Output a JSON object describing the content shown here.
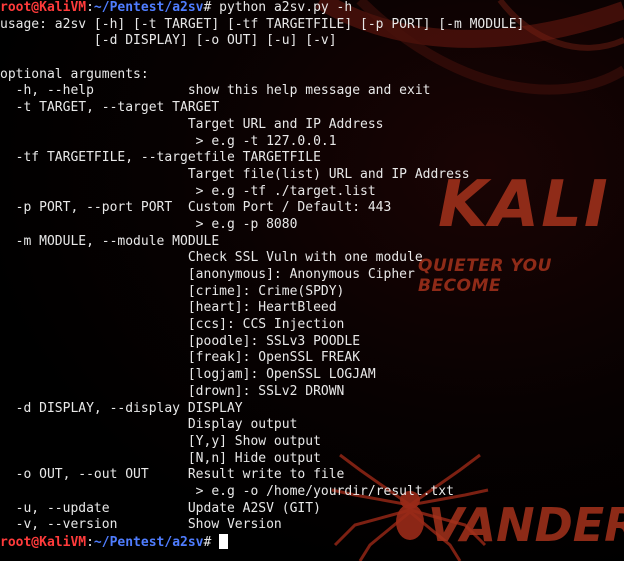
{
  "prompt": {
    "user_host": "root@KaliVM",
    "separator": ":",
    "path": "~/Pentest/a2sv",
    "symbol": "# "
  },
  "command": "python a2sv.py -h",
  "lines": [
    "usage: a2sv [-h] [-t TARGET] [-tf TARGETFILE] [-p PORT] [-m MODULE]",
    "            [-d DISPLAY] [-o OUT] [-u] [-v]",
    "",
    "optional arguments:",
    "  -h, --help            show this help message and exit",
    "  -t TARGET, --target TARGET",
    "                        Target URL and IP Address",
    "                         > e.g -t 127.0.0.1",
    "  -tf TARGETFILE, --targetfile TARGETFILE",
    "                        Target file(list) URL and IP Address",
    "                         > e.g -tf ./target.list",
    "  -p PORT, --port PORT  Custom Port / Default: 443",
    "                         > e.g -p 8080",
    "  -m MODULE, --module MODULE",
    "                        Check SSL Vuln with one module",
    "                        [anonymous]: Anonymous Cipher",
    "                        [crime]: Crime(SPDY)",
    "                        [heart]: HeartBleed",
    "                        [ccs]: CCS Injection",
    "                        [poodle]: SSLv3 POODLE",
    "                        [freak]: OpenSSL FREAK",
    "                        [logjam]: OpenSSL LOGJAM",
    "                        [drown]: SSLv2 DROWN",
    "  -d DISPLAY, --display DISPLAY",
    "                        Display output",
    "                        [Y,y] Show output",
    "                        [N,n] Hide output",
    "  -o OUT, --out OUT     Result write to file",
    "                         > e.g -o /home/yourdir/result.txt",
    "  -u, --update          Update A2SV (GIT)",
    "  -v, --version         Show Version"
  ],
  "wallpaper": {
    "logo": "KALI",
    "slogan": "QUIETER YOU BECOME",
    "artist": "VANDER",
    "accent_color": "#a5321c"
  },
  "colors": {
    "prompt_user": "#ff3b3b",
    "prompt_path": "#4f7dff",
    "text": "#e8e8e8",
    "background": "#000000"
  }
}
